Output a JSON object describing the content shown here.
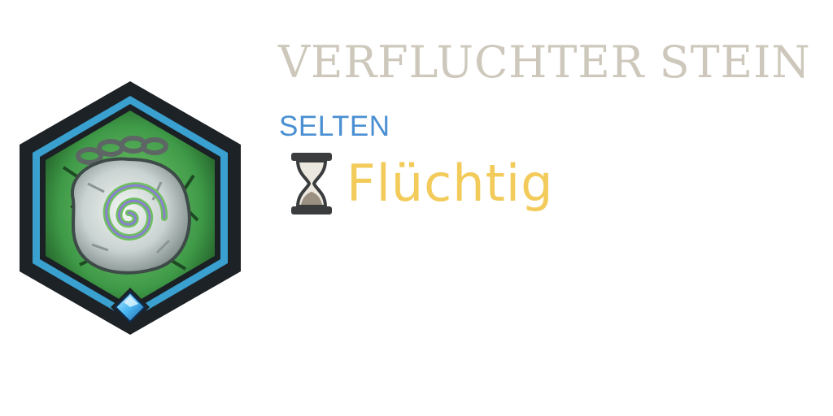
{
  "item": {
    "name": "VERFLUCHTER STEIN",
    "rarity": "SELTEN",
    "duration_label": "Flüchtig",
    "icon": "cursed-stone-icon",
    "status_icon": "hourglass-icon"
  },
  "colors": {
    "name": "#cdc8bb",
    "rarity": "#4a90d2",
    "duration": "#f2cb5a",
    "frame_outer": "#1d2226",
    "frame_blue": "#3aa0cf",
    "icon_background": "#3f9a48",
    "gem": "#4ab8f2"
  }
}
